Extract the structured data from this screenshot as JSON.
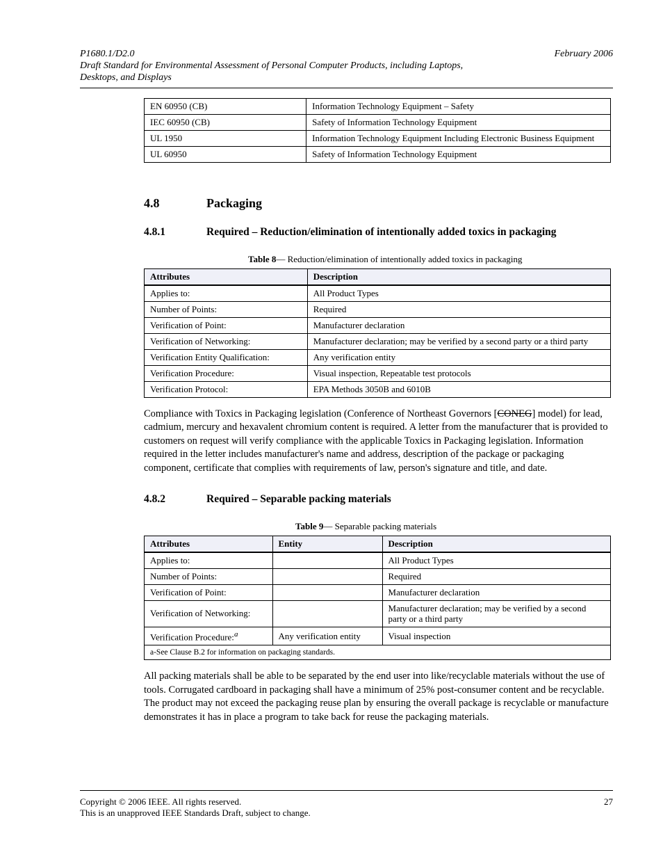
{
  "header": {
    "left_top": "P1680.1/D2.0",
    "left_bot": "Draft Standard for Environmental Assessment of Personal Computer Products, including Laptops, Desktops, and Displays",
    "right": "February 2006"
  },
  "table7_tail": {
    "rows": [
      {
        "c1": "EN 60950 (CB)",
        "c2": "Information Technology Equipment – Safety"
      },
      {
        "c1": "IEC 60950 (CB)",
        "c2": "Safety of Information Technology Equipment"
      },
      {
        "c1": "UL 1950",
        "c2": "Information Technology Equipment Including Electronic Business Equipment"
      },
      {
        "c1": "UL 60950",
        "c2": "Safety of Information Technology Equipment"
      }
    ]
  },
  "section48": {
    "num": "4.8",
    "title": "Packaging"
  },
  "section481": {
    "num": "4.8.1",
    "title": "Required – Reduction/elimination of intentionally added toxics in packaging"
  },
  "table8": {
    "caption_a": "Table 8",
    "caption_b": "— Reduction/elimination of intentionally added toxics in packaging",
    "head": {
      "c1": "Attributes",
      "c2": "Description"
    },
    "rows": [
      {
        "c1": "Applies to:",
        "c2": "All Product Types"
      },
      {
        "c1": "Number of Points:",
        "c2": "Required"
      },
      {
        "c1": "Verification of Point:",
        "c2": "Manufacturer declaration"
      },
      {
        "c1": "Verification of Networking:",
        "c2": "Manufacturer declaration; may be verified by a second party or a third party"
      },
      {
        "c1": "Verification Entity Qualification:",
        "c2": "Any verification entity"
      },
      {
        "c1": "Verification Procedure:",
        "c2": "Visual inspection, Repeatable test protocols"
      },
      {
        "c1": "Verification Protocol:",
        "c2": "EPA Methods 3050B and 6010B"
      }
    ]
  },
  "para48_html": "Compliance with Toxics in Packaging legislation (Conference of Northeast Governors [<s>CONEG</s>] model) for lead, cadmium, mercury and hexavalent chromium content is required. A letter from the manufacturer that is provided to customers on request will verify compliance with the applicable Toxics in Packaging legislation. Information required in the letter includes manufacturer's name and address, description of the package or packaging component, certificate that complies with requirements of law, person's signature and title, and date.",
  "section482": {
    "num": "4.8.2",
    "title": "Required – Separable packing materials"
  },
  "table9": {
    "caption_a": "Table 9",
    "caption_b": "— Separable packing materials",
    "head": {
      "c1": "Attributes",
      "c2": "Entity",
      "c3": "Description"
    },
    "rows": [
      {
        "c1": "Applies to:",
        "c2": "",
        "c3": "All Product Types"
      },
      {
        "c1": "Number of Points:",
        "c2": "",
        "c3": "Required"
      },
      {
        "c1": "Verification of Point:",
        "c2": "",
        "c3": "Manufacturer declaration"
      },
      {
        "c1": "Verification of Networking:",
        "c2": "",
        "c3": "Manufacturer declaration; may be verified by a second party or a third party"
      },
      {
        "c1_html": "Verification Procedure:<span class=\"footnote-a\">a</span>",
        "c2": "Any verification entity",
        "c3": "Visual inspection"
      }
    ],
    "footnote": "a‑See Clause B.2 for information on packaging standards."
  },
  "para482": "All packing materials shall be able to be separated by the end user into like/recyclable materials without the use of tools. Corrugated cardboard in packaging shall have a minimum of 25% post-consumer content and be recyclable. The product may not exceed the packaging reuse plan by ensuring the overall package is recyclable or manufacture demonstrates it has in place a program to take back for reuse the packaging materials.",
  "footer": {
    "left1": "Copyright © 2006 IEEE. All rights reserved.",
    "left2": "This is an unapproved IEEE Standards Draft, subject to change.",
    "right1": "27",
    "right2": ""
  }
}
